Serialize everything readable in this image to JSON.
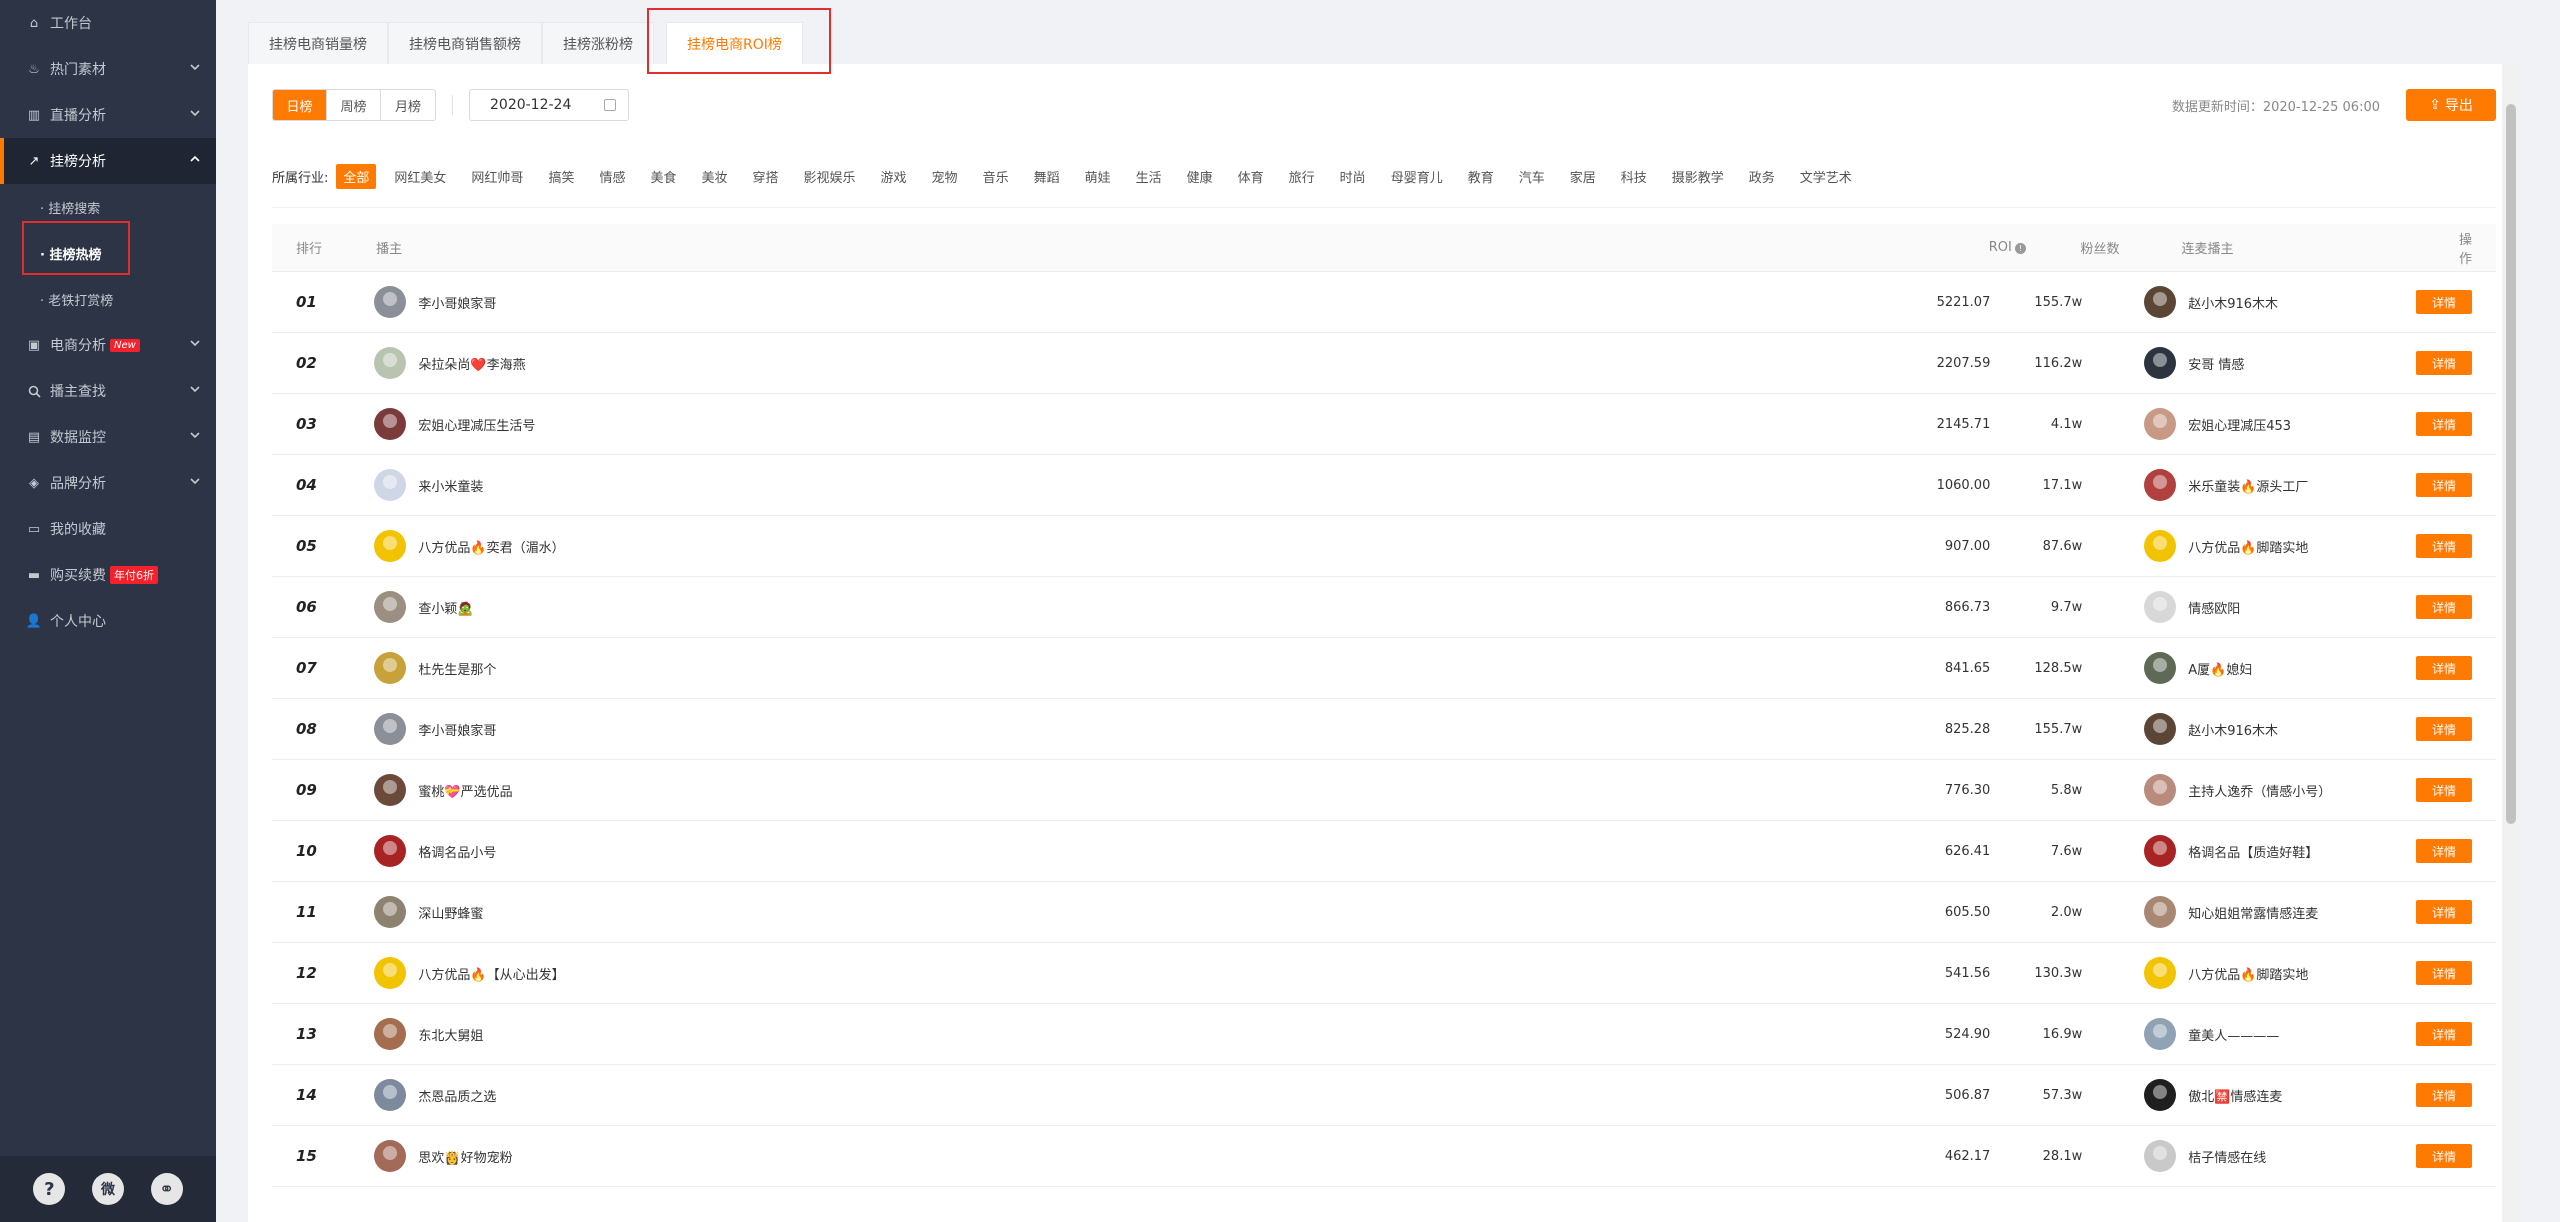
{
  "sidebar": {
    "items": [
      {
        "label": "工作台",
        "icon": "home-icon"
      },
      {
        "label": "热门素材",
        "icon": "fire-icon"
      },
      {
        "label": "直播分析",
        "icon": "bar-chart-icon"
      },
      {
        "label": "挂榜分析",
        "icon": "trend-icon"
      },
      {
        "label": "电商分析",
        "icon": "shop-icon",
        "badge": "New"
      },
      {
        "label": "播主查找",
        "icon": "search-icon"
      },
      {
        "label": "数据监控",
        "icon": "monitor-icon"
      },
      {
        "label": "品牌分析",
        "icon": "brand-icon"
      },
      {
        "label": "我的收藏",
        "icon": "collect-icon"
      },
      {
        "label": "购买续费",
        "icon": "card-icon",
        "badge": "年付6折"
      },
      {
        "label": "个人中心",
        "icon": "user-icon"
      }
    ],
    "sub_items": [
      {
        "label": "· 挂榜搜索"
      },
      {
        "label": "· 挂榜热榜"
      },
      {
        "label": "· 老铁打赏榜"
      }
    ],
    "footer": {
      "help": "?",
      "wechat": "微",
      "link": "⚭"
    }
  },
  "tabs": [
    {
      "label": "挂榜电商销量榜"
    },
    {
      "label": "挂榜电商销售额榜"
    },
    {
      "label": "挂榜涨粉榜"
    },
    {
      "label": "挂榜电商ROI榜"
    }
  ],
  "toolbar": {
    "period_day": "日榜",
    "period_week": "周榜",
    "period_month": "月榜",
    "date": "2020-12-24",
    "update_label": "数据更新时间：2020-12-25 06:00",
    "export_label": "导出"
  },
  "categories": {
    "label": "所属行业:",
    "items": [
      "全部",
      "网红美女",
      "网红帅哥",
      "搞笑",
      "情感",
      "美食",
      "美妆",
      "穿搭",
      "影视娱乐",
      "游戏",
      "宠物",
      "音乐",
      "舞蹈",
      "萌娃",
      "生活",
      "健康",
      "体育",
      "旅行",
      "时尚",
      "母婴育儿",
      "教育",
      "汽车",
      "家居",
      "科技",
      "摄影教学",
      "政务",
      "文学艺术"
    ]
  },
  "table": {
    "headers": {
      "rank": "排行",
      "anchor": "播主",
      "roi": "ROI",
      "fans": "粉丝数",
      "partner": "连麦播主",
      "op": "操作"
    },
    "detail_label": "详情",
    "rows": [
      {
        "rank": "01",
        "anchor": "李小哥娘家哥",
        "roi": "5221.07",
        "fans": "155.7w",
        "partner": "赵小木916木木",
        "a_color": "#8a8f98",
        "p_color": "#5b4636"
      },
      {
        "rank": "02",
        "anchor": "朵拉朵尚❤️李海燕",
        "roi": "2207.59",
        "fans": "116.2w",
        "partner": "安哥 情感",
        "a_color": "#b9c4b0",
        "p_color": "#2c3440"
      },
      {
        "rank": "03",
        "anchor": "宏姐心理减压生活号",
        "roi": "2145.71",
        "fans": "4.1w",
        "partner": "宏姐心理减压453",
        "a_color": "#7c3b3b",
        "p_color": "#c89a86"
      },
      {
        "rank": "04",
        "anchor": "来小米童装",
        "roi": "1060.00",
        "fans": "17.1w",
        "partner": "米乐童装🔥源头工厂",
        "a_color": "#cfd7e6",
        "p_color": "#b0413e"
      },
      {
        "rank": "05",
        "anchor": "八方优品🔥奕君（湄水）",
        "roi": "907.00",
        "fans": "87.6w",
        "partner": "八方优品🔥脚踏实地",
        "a_color": "#f2c300",
        "p_color": "#f2c300"
      },
      {
        "rank": "06",
        "anchor": "查小颖🧟",
        "roi": "866.73",
        "fans": "9.7w",
        "partner": "情感欧阳",
        "a_color": "#9a8f80",
        "p_color": "#d8d8d8"
      },
      {
        "rank": "07",
        "anchor": "杜先生是那个",
        "roi": "841.65",
        "fans": "128.5w",
        "partner": "A厦🔥媳妇",
        "a_color": "#c7a13a",
        "p_color": "#5e6a56"
      },
      {
        "rank": "08",
        "anchor": "李小哥娘家哥",
        "roi": "825.28",
        "fans": "155.7w",
        "partner": "赵小木916木木",
        "a_color": "#8a8f98",
        "p_color": "#5b4636"
      },
      {
        "rank": "09",
        "anchor": "蜜桃💝严选优品",
        "roi": "776.30",
        "fans": "5.8w",
        "partner": "主持人逸乔（情感小号）",
        "a_color": "#6b4a3a",
        "p_color": "#b98b7d"
      },
      {
        "rank": "10",
        "anchor": "格调名品小号",
        "roi": "626.41",
        "fans": "7.6w",
        "partner": "格调名品【质造好鞋】",
        "a_color": "#a82424",
        "p_color": "#a82424"
      },
      {
        "rank": "11",
        "anchor": "深山野蜂蜜",
        "roi": "605.50",
        "fans": "2.0w",
        "partner": "知心姐姐常露情感连麦",
        "a_color": "#8d8270",
        "p_color": "#a98873"
      },
      {
        "rank": "12",
        "anchor": "八方优品🔥【从心出发】",
        "roi": "541.56",
        "fans": "130.3w",
        "partner": "八方优品🔥脚踏实地",
        "a_color": "#f2c300",
        "p_color": "#f2c300"
      },
      {
        "rank": "13",
        "anchor": "东北大舅姐",
        "roi": "524.90",
        "fans": "16.9w",
        "partner": "童美人————",
        "a_color": "#a46d4f",
        "p_color": "#8fa3b5"
      },
      {
        "rank": "14",
        "anchor": "杰恩品质之选",
        "roi": "506.87",
        "fans": "57.3w",
        "partner": "傲北🈲情感连麦",
        "a_color": "#7d8a9e",
        "p_color": "#1f1f1f"
      },
      {
        "rank": "15",
        "anchor": "思欢👸好物宠粉",
        "roi": "462.17",
        "fans": "28.1w",
        "partner": "桔子情感在线",
        "a_color": "#a36a59",
        "p_color": "#c9c9c9"
      }
    ]
  }
}
